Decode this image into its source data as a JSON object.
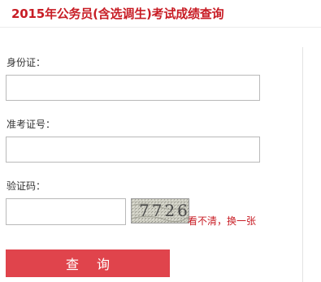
{
  "header": {
    "title": "2015年公务员(含选调生)考试成绩查询"
  },
  "form": {
    "id_label": "身份证：",
    "id_value": "",
    "ticket_label": "准考证号：",
    "ticket_value": "",
    "captcha_label": "验证码：",
    "captcha_value": "",
    "captcha_image_text": "7726",
    "refresh_link": "看不清，换一张",
    "submit_label": "查询"
  },
  "colors": {
    "title": "#c81d25",
    "submit_bg": "#e0444c",
    "link": "#c81d25"
  }
}
